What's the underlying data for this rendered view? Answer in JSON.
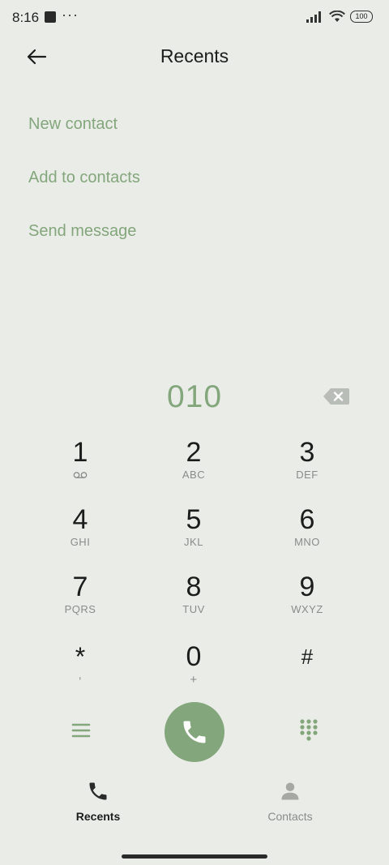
{
  "status_bar": {
    "time": "8:16",
    "dots": "···",
    "battery": "100"
  },
  "header": {
    "title": "Recents"
  },
  "actions": {
    "new_contact": "New contact",
    "add_to_contacts": "Add to contacts",
    "send_message": "Send message"
  },
  "dialer": {
    "number": "010"
  },
  "keypad": {
    "k1": {
      "digit": "1",
      "letters": ""
    },
    "k2": {
      "digit": "2",
      "letters": "ABC"
    },
    "k3": {
      "digit": "3",
      "letters": "DEF"
    },
    "k4": {
      "digit": "4",
      "letters": "GHI"
    },
    "k5": {
      "digit": "5",
      "letters": "JKL"
    },
    "k6": {
      "digit": "6",
      "letters": "MNO"
    },
    "k7": {
      "digit": "7",
      "letters": "PQRS"
    },
    "k8": {
      "digit": "8",
      "letters": "TUV"
    },
    "k9": {
      "digit": "9",
      "letters": "WXYZ"
    },
    "kstar": {
      "digit": "*",
      "letters": ","
    },
    "k0": {
      "digit": "0",
      "letters": "+"
    },
    "khash": {
      "digit": "#",
      "letters": ""
    }
  },
  "nav": {
    "recents": "Recents",
    "contacts": "Contacts"
  },
  "colors": {
    "accent": "#84a67c",
    "background": "#e9ece7",
    "active_nav": "#1d1d1d",
    "inactive_nav": "#8b8b8b"
  }
}
